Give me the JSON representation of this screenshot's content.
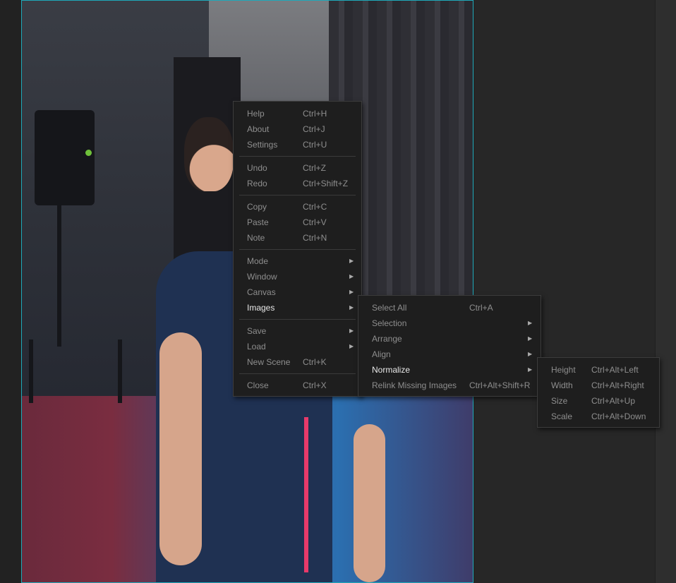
{
  "main_menu": {
    "groups": [
      [
        {
          "label": "Help",
          "shortcut": "Ctrl+H"
        },
        {
          "label": "About",
          "shortcut": "Ctrl+J"
        },
        {
          "label": "Settings",
          "shortcut": "Ctrl+U"
        }
      ],
      [
        {
          "label": "Undo",
          "shortcut": "Ctrl+Z"
        },
        {
          "label": "Redo",
          "shortcut": "Ctrl+Shift+Z"
        }
      ],
      [
        {
          "label": "Copy",
          "shortcut": "Ctrl+C"
        },
        {
          "label": "Paste",
          "shortcut": "Ctrl+V"
        },
        {
          "label": "Note",
          "shortcut": "Ctrl+N"
        }
      ],
      [
        {
          "label": "Mode",
          "submenu_arrow": "▶"
        },
        {
          "label": "Window",
          "submenu_arrow": "▶"
        },
        {
          "label": "Canvas",
          "submenu_arrow": "▶"
        },
        {
          "label": "Images",
          "submenu_arrow": "▶"
        }
      ],
      [
        {
          "label": "Save",
          "submenu_arrow": "▶"
        },
        {
          "label": "Load",
          "submenu_arrow": "▶"
        },
        {
          "label": "New Scene",
          "shortcut": "Ctrl+K"
        }
      ],
      [
        {
          "label": "Close",
          "shortcut": "Ctrl+X"
        }
      ]
    ]
  },
  "images_menu": {
    "items": [
      {
        "label": "Select All",
        "shortcut": "Ctrl+A"
      },
      {
        "label": "Selection",
        "submenu_arrow": "▶"
      },
      {
        "label": "Arrange",
        "submenu_arrow": "▶"
      },
      {
        "label": "Align",
        "submenu_arrow": "▶"
      },
      {
        "label": "Normalize",
        "submenu_arrow": "▶"
      },
      {
        "label": "Relink Missing Images",
        "shortcut": "Ctrl+Alt+Shift+R"
      }
    ]
  },
  "normalize_menu": {
    "items": [
      {
        "label": "Height",
        "shortcut": "Ctrl+Alt+Left"
      },
      {
        "label": "Width",
        "shortcut": "Ctrl+Alt+Right"
      },
      {
        "label": "Size",
        "shortcut": "Ctrl+Alt+Up"
      },
      {
        "label": "Scale",
        "shortcut": "Ctrl+Alt+Down"
      }
    ]
  },
  "colors": {
    "accent_border": "#1fa9b9",
    "menu_bg": "#1e1e1e",
    "menu_text": "#8e8e8e",
    "menu_text_active": "#e8e8e8"
  },
  "icons": {
    "submenu": "chevron-right-icon"
  }
}
